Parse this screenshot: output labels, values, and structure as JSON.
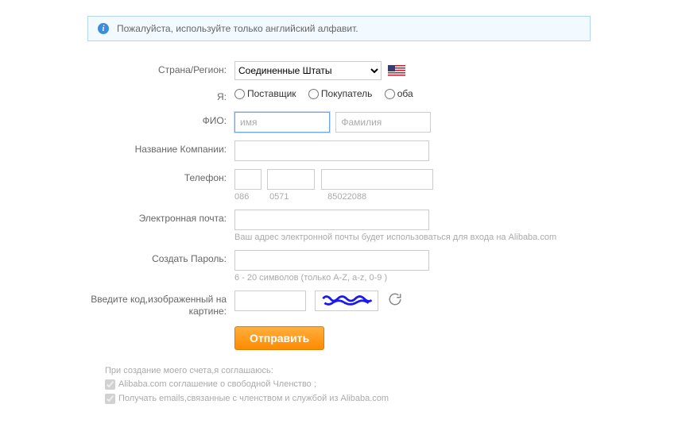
{
  "info_banner": "Пожалуйста, используйте только английский алфавит.",
  "labels": {
    "country": "Страна/Регион:",
    "role": "Я:",
    "name": "ФИО:",
    "company": "Название Компании:",
    "phone": "Телефон:",
    "email": "Электронная почта:",
    "password": "Создать Пароль:",
    "captcha": "Введите код,изображенный на картине:"
  },
  "country": {
    "selected": "Соединенные Штаты"
  },
  "role_options": {
    "supplier": "Поставщик",
    "buyer": "Покупатель",
    "both": "оба"
  },
  "name": {
    "first_placeholder": "имя",
    "last_placeholder": "Фамилия"
  },
  "phone_hints": {
    "cc": "086",
    "area": "0571",
    "num": "85022088"
  },
  "email_hint": "Ваш адрес электронной почты будет использоваться для входа на Alibaba.com",
  "password_hint": "6 - 20 символов (только A-Z, a-z, 0-9 )",
  "submit_label": "Отправить",
  "agreement": {
    "intro": "При создание моего счета,я соглашаюсь:",
    "line1": "Alibaba.com соглашение о свободной Членство ;",
    "line2": "Получать emails,связанные с членством и службой из Alibaba.com"
  }
}
